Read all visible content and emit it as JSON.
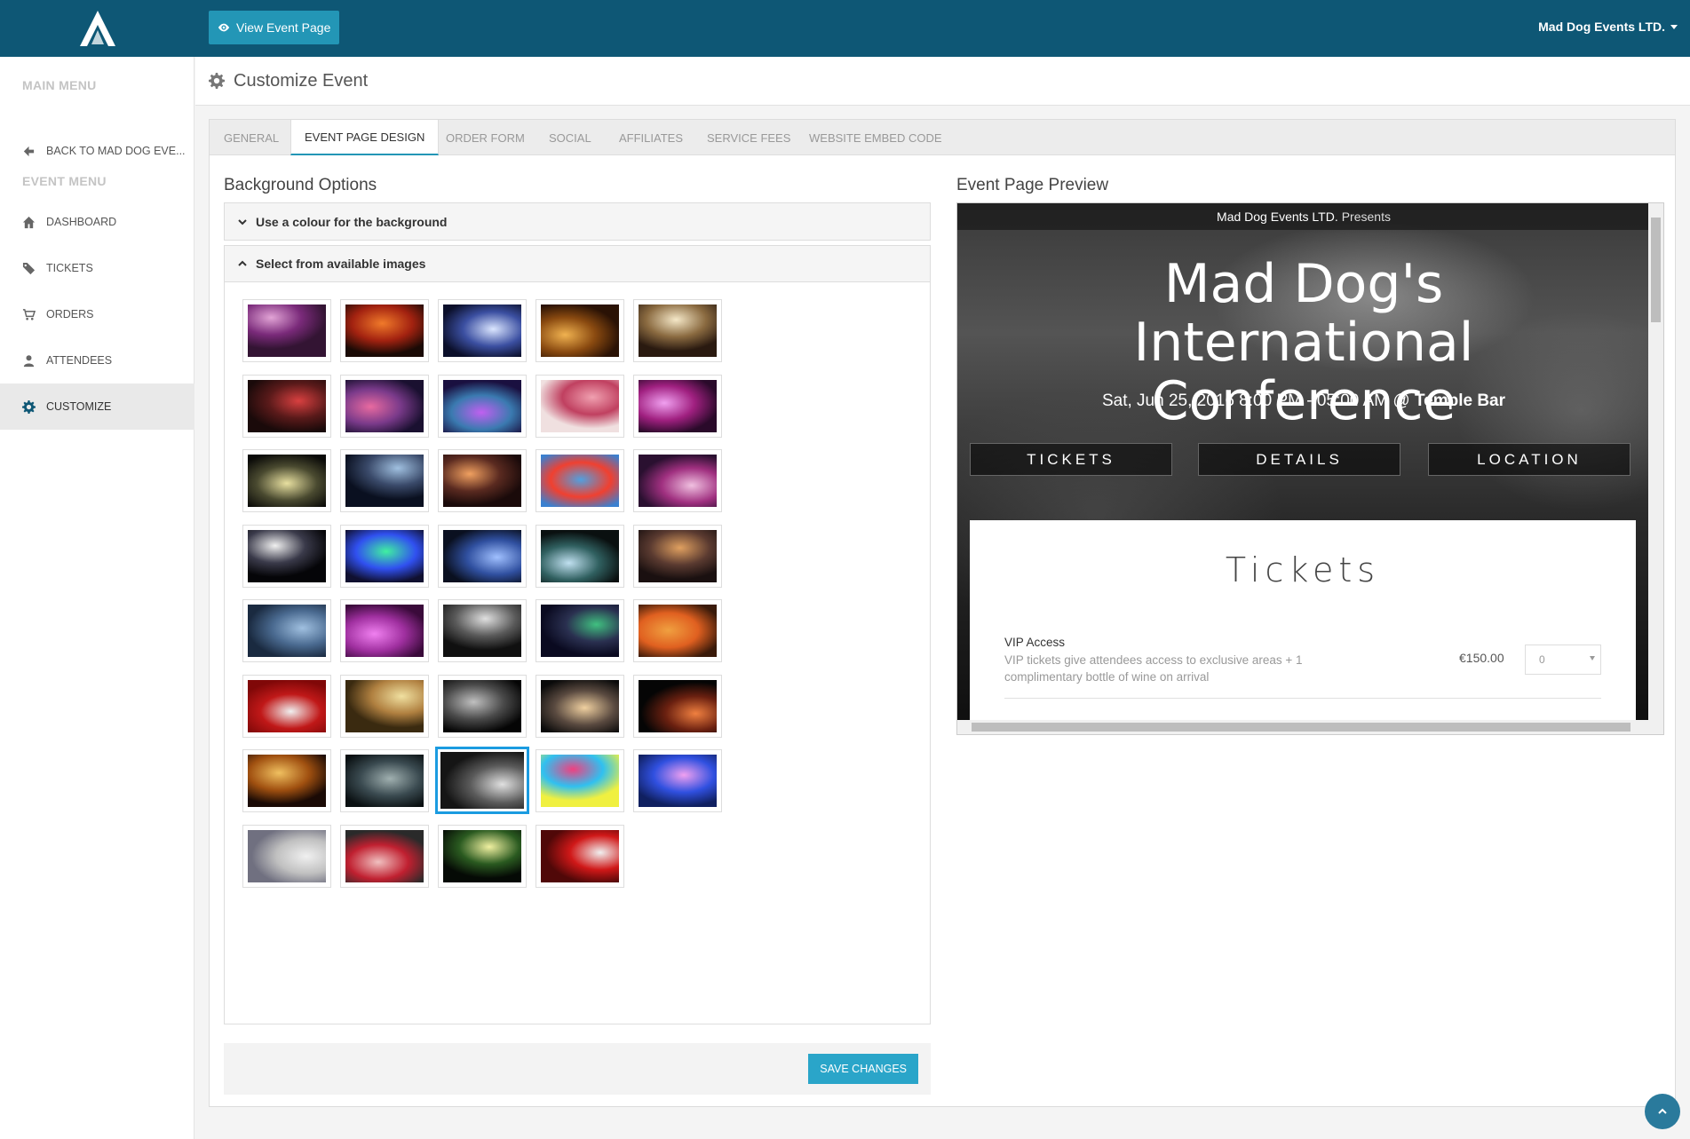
{
  "topbar": {
    "logo": "app-logo",
    "view_event_label": "View Event Page",
    "organiser": "Mad Dog Events LTD."
  },
  "sidebar": {
    "main_menu_heading": "MAIN MENU",
    "back_label": "BACK TO MAD DOG EVE...",
    "event_menu_heading": "EVENT MENU",
    "items": [
      {
        "label": "DASHBOARD",
        "icon": "home-icon"
      },
      {
        "label": "TICKETS",
        "icon": "ticket-icon"
      },
      {
        "label": "ORDERS",
        "icon": "cart-icon"
      },
      {
        "label": "ATTENDEES",
        "icon": "user-icon"
      },
      {
        "label": "CUSTOMIZE",
        "icon": "gear-icon",
        "active": true
      }
    ]
  },
  "page": {
    "title": "Customize Event"
  },
  "tabs": [
    {
      "label": "GENERAL"
    },
    {
      "label": "EVENT PAGE DESIGN",
      "active": true
    },
    {
      "label": "ORDER FORM"
    },
    {
      "label": "SOCIAL"
    },
    {
      "label": "AFFILIATES"
    },
    {
      "label": "SERVICE FEES"
    },
    {
      "label": "WEBSITE EMBED CODE"
    }
  ],
  "background_options": {
    "title": "Background Options",
    "colour_option": "Use a colour for the background",
    "images_option": "Select from available images",
    "image_count": 39,
    "selected_index": 32,
    "save_label": "SAVE CHANGES"
  },
  "preview": {
    "title": "Event Page Preview",
    "presenter": "Mad Dog Events LTD.",
    "presents": "Presents",
    "event_title": "Mad Dog's International Conference",
    "date_text": "Sat, Jun 25, 2016 8:00 PM - 05:00 AM @",
    "venue": "Temple Bar",
    "buttons": [
      "TICKETS",
      "DETAILS",
      "LOCATION"
    ],
    "tickets_heading": "Tickets",
    "ticket": {
      "name": "VIP Access",
      "description": "VIP tickets give attendees access to exclusive areas + 1 complimentary bottle of wine on arrival",
      "price": "€150.00",
      "quantity": "0"
    }
  },
  "colors": {
    "topbar": "#0e5775",
    "accent": "#2396b6",
    "selected_border": "#1b9be0"
  }
}
